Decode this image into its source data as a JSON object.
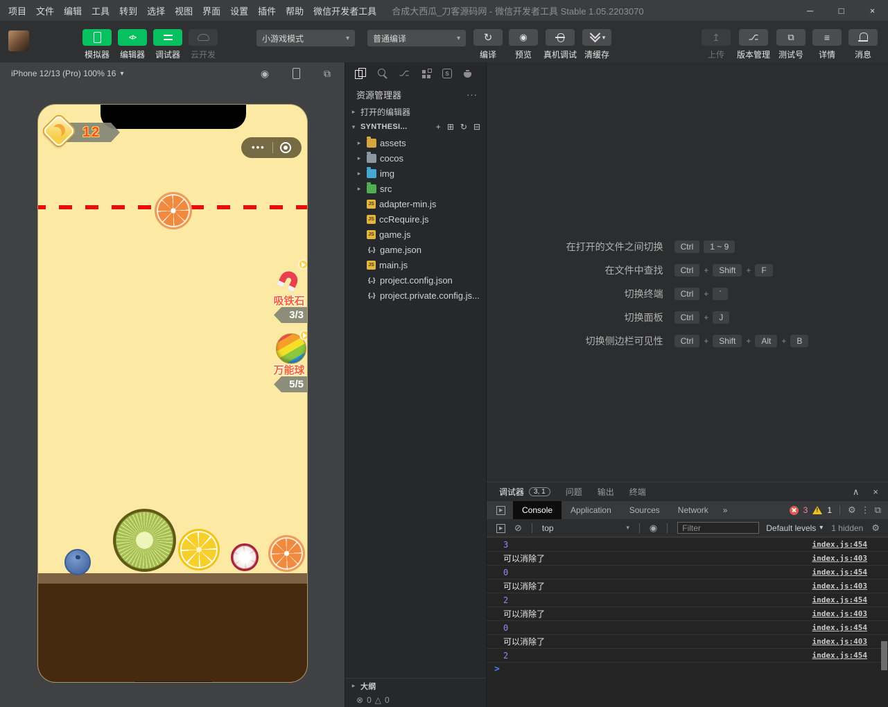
{
  "window": {
    "menu": [
      "项目",
      "文件",
      "编辑",
      "工具",
      "转到",
      "选择",
      "视图",
      "界面",
      "设置",
      "插件",
      "帮助",
      "微信开发者工具"
    ],
    "title": "合成大西瓜_刀客源码网 - 微信开发者工具 Stable 1.05.2203070",
    "controls": [
      {
        "glyph": "─",
        "name": "minimize"
      },
      {
        "glyph": "□",
        "name": "maximize"
      },
      {
        "glyph": "×",
        "name": "close"
      }
    ]
  },
  "ui": {
    "caret": "▾"
  },
  "toolbar": {
    "modes": [
      {
        "label": "模拟器",
        "icon": "i-phone",
        "cls": "active",
        "glyph": ""
      },
      {
        "label": "编辑器",
        "icon": "i-code",
        "cls": "active",
        "glyph": "</>"
      },
      {
        "label": "调试器",
        "icon": "i-toggles",
        "cls": "active",
        "glyph": ""
      },
      {
        "label": "云开发",
        "icon": "i-cloud",
        "cls": "disabled",
        "glyph": ""
      }
    ],
    "mode_select": "小游戏模式",
    "compile_select": "普通编译",
    "actions": [
      {
        "label": "编译",
        "icon": "i-refresh",
        "glyph": "↻"
      },
      {
        "label": "预览",
        "icon": "i-eye",
        "glyph": "◉"
      },
      {
        "label": "真机调试",
        "icon": "i-bug",
        "glyph": ""
      },
      {
        "label": "清缓存",
        "icon": "i-layers",
        "glyph": "",
        "caret": "▾"
      }
    ],
    "right_actions": [
      {
        "label": "上传",
        "icon": "i-upload",
        "cls": "disabled",
        "glyph": "↥"
      },
      {
        "label": "版本管理",
        "icon": "i-branch",
        "glyph": "⌥"
      },
      {
        "label": "测试号",
        "icon": "i-external",
        "glyph": "⧉"
      },
      {
        "label": "详情",
        "icon": "i-menu",
        "glyph": "≡"
      },
      {
        "label": "消息",
        "icon": "i-bell",
        "glyph": ""
      }
    ]
  },
  "simulator": {
    "device": "iPhone 12/13 (Pro) 100% 16",
    "bar_icons": [
      {
        "icon": "s-record",
        "glyph": "◉",
        "name": "record-icon"
      },
      {
        "icon": "i-phone",
        "glyph": "",
        "name": "device-icon"
      },
      {
        "icon": "s-windows",
        "glyph": "⧉",
        "name": "multi-window-icon"
      }
    ],
    "game": {
      "score": "12",
      "capsule_dots": "•••",
      "hanging_fruit": "orange",
      "bottom_fruits": [
        "blueberry",
        "kiwi",
        "lemon",
        "mangosteen",
        "orange"
      ],
      "powerups": [
        {
          "name": "吸铁石",
          "count": "3/3"
        },
        {
          "name": "万能球",
          "count": "5/5"
        }
      ]
    }
  },
  "explorer": {
    "activity": [
      {
        "icon": "a-files active",
        "glyph": "",
        "name": "files-icon"
      },
      {
        "icon": "a-search",
        "glyph": "",
        "name": "search-icon"
      },
      {
        "icon": "a-branch",
        "glyph": "⌥",
        "name": "source-control-icon"
      },
      {
        "icon": "a-ext",
        "glyph": "",
        "name": "extensions-icon"
      },
      {
        "icon": "a-sbox",
        "glyph": "S",
        "name": "s-box-icon"
      },
      {
        "icon": "a-teapot",
        "glyph": "",
        "name": "teapot-icon"
      }
    ],
    "title": "资源管理器",
    "more": "···",
    "open_editors": {
      "arrow": "▸",
      "label": "打开的编辑器"
    },
    "project": {
      "arrow": "▾",
      "label": "SYNTHESI...",
      "actions": [
        {
          "glyph": "+"
        },
        {
          "glyph": "⊞"
        },
        {
          "glyph": "↻"
        },
        {
          "glyph": "⊟"
        }
      ]
    },
    "files": [
      {
        "name": "assets",
        "icon": "folder f-assets",
        "arrow": "▸",
        "expandable": true
      },
      {
        "name": "cocos",
        "icon": "folder f-cocos",
        "arrow": "▸",
        "expandable": true
      },
      {
        "name": "img",
        "icon": "folder f-img",
        "arrow": "▸",
        "expandable": true
      },
      {
        "name": "src",
        "icon": "folder f-src",
        "arrow": "▸",
        "expandable": true
      },
      {
        "name": "adapter-min.js",
        "icon": "js",
        "badge": "JS"
      },
      {
        "name": "ccRequire.js",
        "icon": "js",
        "badge": "JS"
      },
      {
        "name": "game.js",
        "icon": "js",
        "badge": "JS"
      },
      {
        "name": "game.json",
        "icon": "json",
        "badge": "{..}"
      },
      {
        "name": "main.js",
        "icon": "js",
        "badge": "JS"
      },
      {
        "name": "project.config.json",
        "icon": "json",
        "badge": "{..}"
      },
      {
        "name": "project.private.config.js...",
        "icon": "json",
        "badge": "{..}"
      }
    ],
    "outline": {
      "arrow": "▸",
      "label": "大纲"
    },
    "status": {
      "error_icon": "⊗",
      "errors": "0",
      "warn_icon": "△",
      "warnings": "0"
    }
  },
  "editor": {
    "shortcuts": [
      {
        "label": "在打开的文件之间切换",
        "tokens": [
          {
            "text": "Ctrl",
            "cls": "keycap"
          },
          {
            "text": "1 ~ 9",
            "cls": "keycap"
          }
        ]
      },
      {
        "label": "在文件中查找",
        "tokens": [
          {
            "text": "Ctrl",
            "cls": "keycap"
          },
          {
            "text": "+",
            "cls": "plus"
          },
          {
            "text": "Shift",
            "cls": "keycap"
          },
          {
            "text": "+",
            "cls": "plus"
          },
          {
            "text": "F",
            "cls": "keycap"
          }
        ]
      },
      {
        "label": "切换终端",
        "tokens": [
          {
            "text": "Ctrl",
            "cls": "keycap"
          },
          {
            "text": "+",
            "cls": "plus"
          },
          {
            "text": "`",
            "cls": "keycap"
          }
        ]
      },
      {
        "label": "切换面板",
        "tokens": [
          {
            "text": "Ctrl",
            "cls": "keycap"
          },
          {
            "text": "+",
            "cls": "plus"
          },
          {
            "text": "J",
            "cls": "keycap"
          }
        ]
      },
      {
        "label": "切换侧边栏可见性",
        "tokens": [
          {
            "text": "Ctrl",
            "cls": "keycap"
          },
          {
            "text": "+",
            "cls": "plus"
          },
          {
            "text": "Shift",
            "cls": "keycap"
          },
          {
            "text": "+",
            "cls": "plus"
          },
          {
            "text": "Alt",
            "cls": "keycap"
          },
          {
            "text": "+",
            "cls": "plus"
          },
          {
            "text": "B",
            "cls": "keycap"
          }
        ]
      }
    ]
  },
  "debuggerPanel": {
    "tabs": [
      {
        "label": "调试器",
        "cls": "active",
        "badge": "3, 1"
      },
      {
        "label": "问题"
      },
      {
        "label": "输出"
      },
      {
        "label": "终端"
      }
    ],
    "collapse_icon": "∧",
    "close_icon": "×",
    "devtools_tabs": [
      {
        "label": "Console",
        "cls": "active"
      },
      {
        "label": "Application"
      },
      {
        "label": "Sources"
      },
      {
        "label": "Network"
      },
      {
        "label": "»",
        "cls": "chev"
      }
    ],
    "errors": "3",
    "warnings": "1",
    "gear_icon": "⚙",
    "kebab_icon": "⋮",
    "dock_icon": "⧉",
    "console_toolbar": {
      "clear_icon": "⊘",
      "context": "top",
      "eye_icon": "◉",
      "filter_placeholder": "Filter",
      "levels": "Default levels",
      "hidden": "1 hidden"
    },
    "rows": [
      {
        "text": "3",
        "cls": "num",
        "link": "index.js:454"
      },
      {
        "text": "可以消除了",
        "cls": "log",
        "link": "index.js:403"
      },
      {
        "text": "0",
        "cls": "num",
        "link": "index.js:454"
      },
      {
        "text": "可以消除了",
        "cls": "log",
        "link": "index.js:403"
      },
      {
        "text": "2",
        "cls": "num",
        "link": "index.js:454"
      },
      {
        "text": "可以消除了",
        "cls": "log",
        "link": "index.js:403"
      },
      {
        "text": "0",
        "cls": "num",
        "link": "index.js:454"
      },
      {
        "text": "可以消除了",
        "cls": "log",
        "link": "index.js:403"
      },
      {
        "text": "2",
        "cls": "num",
        "link": "index.js:454"
      }
    ],
    "prompt": ">"
  }
}
